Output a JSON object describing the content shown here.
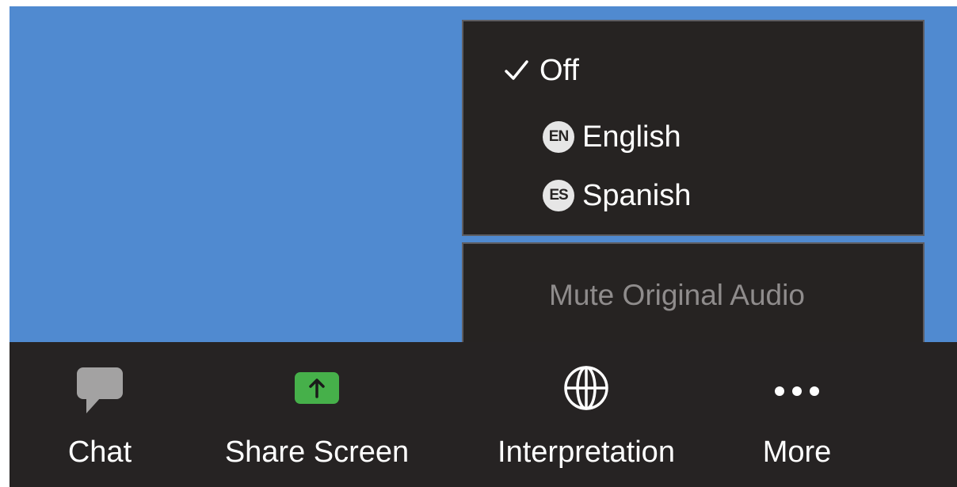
{
  "interpretation_menu": {
    "options": [
      {
        "label": "Off",
        "selected": true,
        "icon": "check-icon"
      },
      {
        "label": "English",
        "badge": "EN",
        "selected": false
      },
      {
        "label": "Spanish",
        "badge": "ES",
        "selected": false
      }
    ],
    "mute_original_audio": "Mute Original Audio"
  },
  "toolbar": {
    "chat": {
      "label": "Chat",
      "icon": "chat-bubble-icon"
    },
    "share_screen": {
      "label": "Share Screen",
      "icon": "share-arrow-icon"
    },
    "interpretation": {
      "label": "Interpretation",
      "icon": "globe-icon"
    },
    "more": {
      "label": "More",
      "icon": "more-dots-icon"
    }
  },
  "colors": {
    "background_blue": "#508ad0",
    "menu_bg": "#262322",
    "toolbar_bg": "#262323",
    "share_green": "#46b04a",
    "chat_gray": "#a3a2a2",
    "muted_text": "#8f8c8c"
  }
}
